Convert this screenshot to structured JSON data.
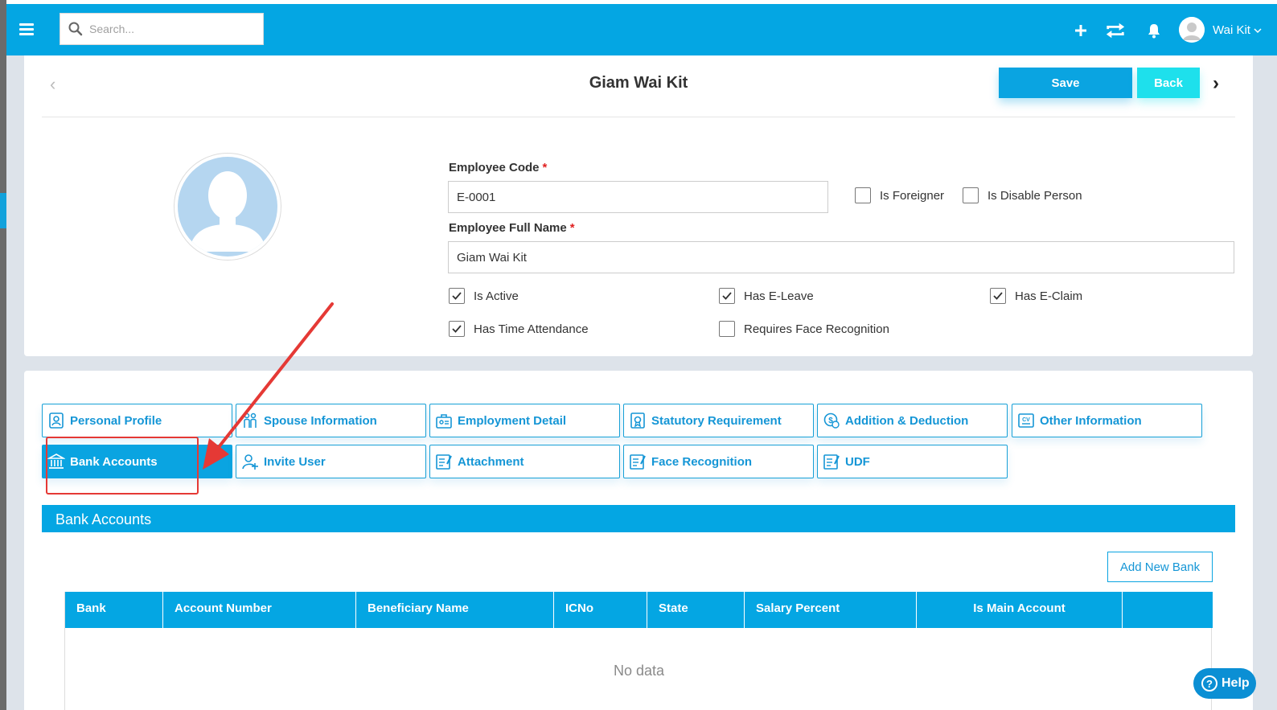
{
  "topbar": {
    "search_placeholder": "Search...",
    "user_name": "Wai Kit",
    "icons": [
      "menu-icon",
      "search-icon",
      "plus-icon",
      "sync-icon",
      "bell-icon",
      "user-avatar",
      "chevron-down-icon"
    ]
  },
  "header": {
    "title": "Giam Wai Kit",
    "save_label": "Save",
    "back_label": "Back"
  },
  "form": {
    "employee_code_label": "Employee Code",
    "employee_code_value": "E-0001",
    "employee_name_label": "Employee Full Name",
    "employee_name_value": "Giam Wai Kit",
    "required_mark": "*",
    "checkboxes": {
      "is_foreigner": {
        "label": "Is Foreigner",
        "checked": false
      },
      "is_disable_person": {
        "label": "Is Disable Person",
        "checked": false
      },
      "is_active": {
        "label": "Is Active",
        "checked": true
      },
      "has_e_leave": {
        "label": "Has E-Leave",
        "checked": true
      },
      "has_e_claim": {
        "label": "Has E-Claim",
        "checked": true
      },
      "has_time_attendance": {
        "label": "Has Time Attendance",
        "checked": true
      },
      "requires_face_recognition": {
        "label": "Requires Face Recognition",
        "checked": false
      }
    }
  },
  "tabs": [
    {
      "label": "Personal Profile",
      "icon": "profile-icon",
      "active": false
    },
    {
      "label": "Spouse Information",
      "icon": "family-icon",
      "active": false
    },
    {
      "label": "Employment Detail",
      "icon": "briefcase-icon",
      "active": false
    },
    {
      "label": "Statutory Requirement",
      "icon": "certificate-icon",
      "active": false
    },
    {
      "label": "Addition & Deduction",
      "icon": "coin-icon",
      "active": false
    },
    {
      "label": "Other Information",
      "icon": "cv-icon",
      "active": false
    },
    {
      "label": "Bank Accounts",
      "icon": "bank-icon",
      "active": true
    },
    {
      "label": "Invite User",
      "icon": "add-user-icon",
      "active": false
    },
    {
      "label": "Attachment",
      "icon": "document-icon",
      "active": false
    },
    {
      "label": "Face Recognition",
      "icon": "document-icon",
      "active": false
    },
    {
      "label": "UDF",
      "icon": "document-icon",
      "active": false
    }
  ],
  "bank_section": {
    "title": "Bank Accounts",
    "add_button": "Add New Bank",
    "columns": [
      "Bank",
      "Account Number",
      "Beneficiary Name",
      "ICNo",
      "State",
      "Salary Percent",
      "Is Main Account",
      ""
    ],
    "rows": [],
    "empty_text": "No data"
  },
  "help": {
    "label": "Help",
    "symbol": "?"
  },
  "colors": {
    "primary": "#04a6e3",
    "accent_cyan": "#1ee0ec",
    "tab_text": "#1596d6",
    "annotation_red": "#e53935",
    "required": "#e02020"
  }
}
